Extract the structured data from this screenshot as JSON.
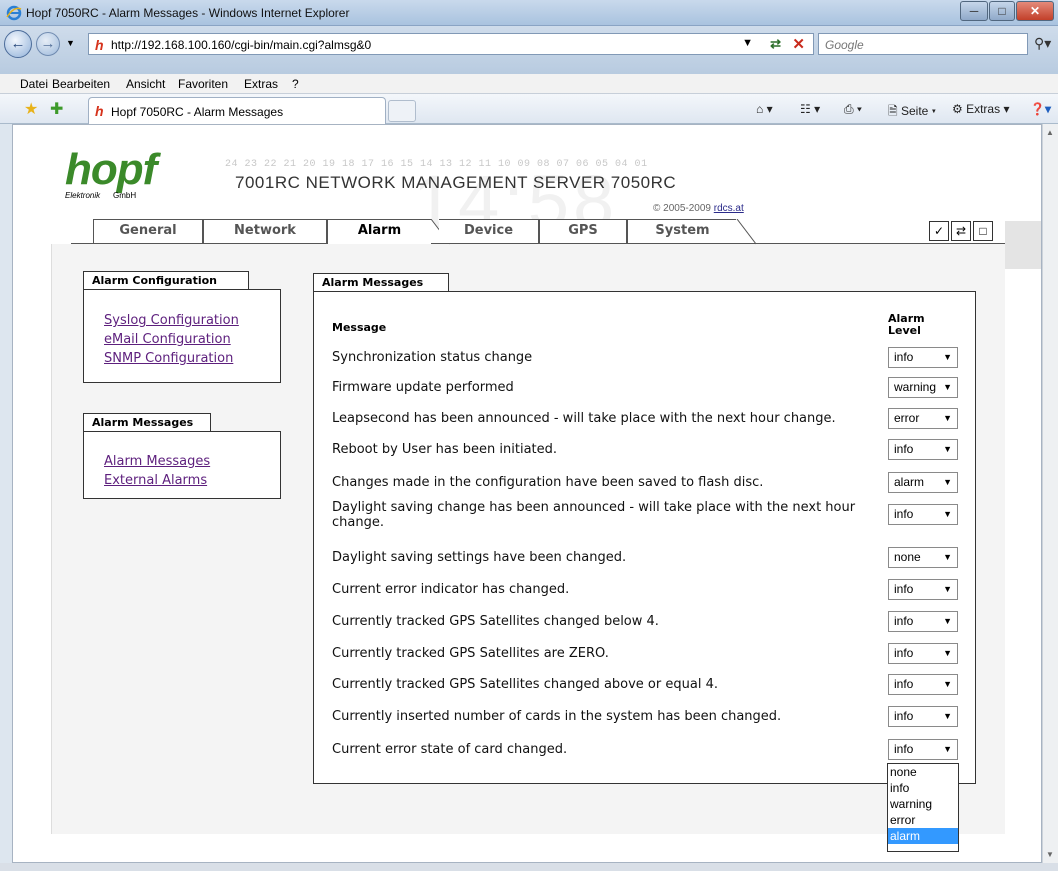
{
  "window": {
    "title": "Hopf 7050RC - Alarm Messages - Windows Internet Explorer"
  },
  "address": {
    "url": "http://192.168.100.160/cgi-bin/main.cgi?almsg&0",
    "search_placeholder": "Google"
  },
  "menu": [
    "Datei",
    "Bearbeiten",
    "Ansicht",
    "Favoriten",
    "Extras",
    "?"
  ],
  "tab": {
    "title": "Hopf 7050RC - Alarm Messages"
  },
  "toolbar": {
    "page_label": "Seite",
    "extras_label": "Extras"
  },
  "header": {
    "logo_text": "hopf",
    "logo_sub1": "Elektronik",
    "logo_sub2": "GmbH",
    "digits": "24 23 22 21 20 19 18 17 16 15 14 13 12 11 10 09 08 07 06 05 04 01",
    "title": "7001RC NETWORK MANAGEMENT SERVER 7050RC",
    "copyright": "© 2005-2009",
    "copyright_link": "rdcs.at",
    "bg_clock": "14:58"
  },
  "nav": {
    "tabs": [
      "General",
      "Network",
      "Alarm",
      "Device",
      "GPS",
      "System"
    ],
    "active": "Alarm"
  },
  "sidebar": {
    "config": {
      "title": "Alarm Configuration",
      "links": [
        "Syslog Configuration",
        "eMail Configuration",
        "SNMP Configuration"
      ]
    },
    "messages": {
      "title": "Alarm Messages",
      "links": [
        "Alarm Messages",
        "External Alarms"
      ]
    }
  },
  "main": {
    "title": "Alarm Messages",
    "col_message": "Message",
    "col_level_1": "Alarm",
    "col_level_2": "Level",
    "rows": [
      {
        "message": "Synchronization status change",
        "level": "info"
      },
      {
        "message": "Firmware update performed",
        "level": "warning"
      },
      {
        "message": "Leapsecond has been announced - will take place with the next hour change.",
        "level": "error"
      },
      {
        "message": "Reboot by User has been initiated.",
        "level": "info"
      },
      {
        "message": "Changes made in the configuration have been saved to flash disc.",
        "level": "alarm"
      },
      {
        "message": "Daylight saving change has been announced - will take place with the next hour change.",
        "level": "info"
      },
      {
        "message": "Daylight saving settings have been changed.",
        "level": "none"
      },
      {
        "message": "Current error indicator has changed.",
        "level": "info"
      },
      {
        "message": "Currently tracked GPS Satellites changed below 4.",
        "level": "info"
      },
      {
        "message": "Currently tracked GPS Satellites are ZERO.",
        "level": "info"
      },
      {
        "message": "Currently tracked GPS Satellites changed above or equal 4.",
        "level": "info"
      },
      {
        "message": "Currently inserted number of cards in the system has been changed.",
        "level": "info"
      },
      {
        "message": "Current error state of card changed.",
        "level": "info"
      }
    ],
    "dropdown_options": [
      "none",
      "info",
      "warning",
      "error",
      "alarm"
    ],
    "dropdown_highlighted": "alarm"
  }
}
